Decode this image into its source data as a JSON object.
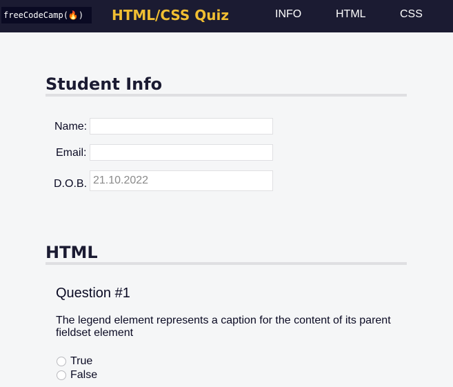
{
  "header": {
    "logo_text": "freeCodeCamp(🔥)",
    "title": "HTML/CSS Quiz",
    "nav": [
      {
        "label": "INFO"
      },
      {
        "label": "HTML"
      },
      {
        "label": "CSS"
      }
    ]
  },
  "student_info": {
    "heading": "Student Info",
    "fields": {
      "name": {
        "label": "Name:",
        "value": ""
      },
      "email": {
        "label": "Email:",
        "value": ""
      },
      "dob": {
        "label": "D.O.B.",
        "value": "21.10.2022"
      }
    }
  },
  "html_section": {
    "heading": "HTML",
    "question": {
      "title": "Question #1",
      "text": "The legend element represents a caption for the content of its parent fieldset element",
      "options": [
        {
          "label": "True",
          "checked": false
        },
        {
          "label": "False",
          "checked": false
        }
      ]
    }
  },
  "colors": {
    "nav_bg": "#1b1b32",
    "title_accent": "#f1be32",
    "page_bg": "#f5f6f7"
  }
}
